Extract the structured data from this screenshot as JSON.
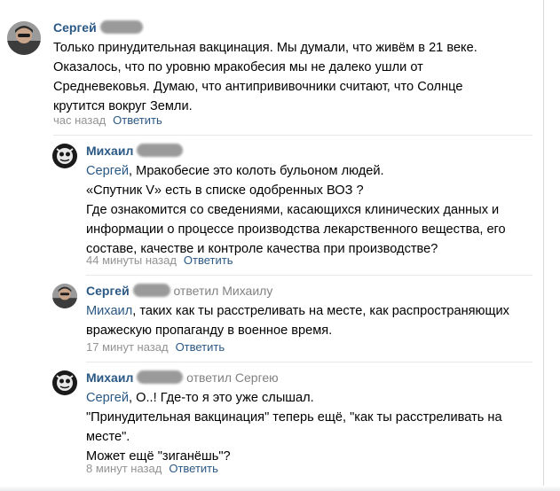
{
  "comments": [
    {
      "author": "Сергей",
      "reply_to": "",
      "lines": [
        "Только принудительная вакцинация. Мы думали, что живём в 21 веке.",
        "Оказалось, что по уровню мракобесия мы не далеко ушли от",
        "Средневековья. Думаю, что антипрививочники считают, что Солнце",
        "крутится вокруг Земли."
      ],
      "time": "час назад",
      "reply_label": "Ответить"
    },
    {
      "author": "Михаил",
      "reply_to": "",
      "mention": "Сергей",
      "lines": [
        ", Мракобесие это колоть бульоном людей.",
        "«Спутник V» есть в списке одобренных ВОЗ ?",
        "Где ознакомится со сведениями, касающихся клинических данных и",
        "информации о процессе производства лекарственного вещества, его",
        "составе, качестве и контроле качества при производстве?"
      ],
      "time": "44 минуты назад",
      "reply_label": "Ответить"
    },
    {
      "author": "Сергей",
      "reply_to": "ответил Михаилу",
      "mention": "Михаил",
      "lines": [
        ", таких как ты расстреливать на месте, как распространяющих",
        "вражескую пропаганду в военное время."
      ],
      "time": "17 минут назад",
      "reply_label": "Ответить"
    },
    {
      "author": "Михаил",
      "reply_to": "ответил Сергею",
      "mention": "Сергей",
      "lines": [
        ", О..! Где-то я это уже слышал.",
        "\"Принудительная вакцинация\" теперь ещё, \"как ты расстреливать на",
        "месте\".",
        "Может ещё \"зиганёшь\"?"
      ],
      "time": "8 минут назад",
      "reply_label": "Ответить"
    }
  ],
  "colors": {
    "link": "#2a5885",
    "meta": "#939393",
    "divider": "#e7e8ec"
  },
  "icons": {
    "avatar_sergey": "person-photo",
    "avatar_mikhail": "cartoon-face"
  }
}
